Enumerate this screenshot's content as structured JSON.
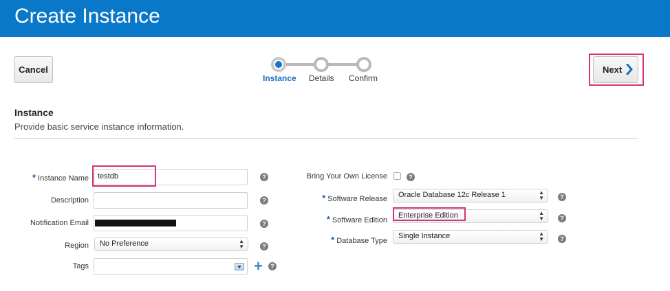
{
  "header": {
    "title": "Create Instance"
  },
  "toolbar": {
    "cancel_label": "Cancel",
    "next_label": "Next"
  },
  "train": {
    "steps": [
      {
        "label": "Instance",
        "active": true
      },
      {
        "label": "Details",
        "active": false
      },
      {
        "label": "Confirm",
        "active": false
      }
    ]
  },
  "section": {
    "title": "Instance",
    "subtitle": "Provide basic service instance information."
  },
  "form_left": {
    "instance_name": {
      "label": "Instance Name",
      "value": "testdb",
      "required": "*"
    },
    "description": {
      "label": "Description",
      "value": ""
    },
    "notification_email": {
      "label": "Notification Email",
      "value": ""
    },
    "region": {
      "label": "Region",
      "value": "No Preference"
    },
    "tags": {
      "label": "Tags",
      "value": ""
    }
  },
  "form_right": {
    "byol": {
      "label": "Bring Your Own License",
      "checked": false
    },
    "software_release": {
      "label": "Software Release",
      "value": "Oracle Database 12c Release 1",
      "required": "*"
    },
    "software_edition": {
      "label": "Software Edition",
      "value": "Enterprise Edition",
      "required": "*"
    },
    "database_type": {
      "label": "Database Type",
      "value": "Single Instance",
      "required": "*"
    }
  },
  "help_glyph": "?",
  "icons": {
    "help": "question-circle-icon",
    "next": "chevron-right-icon",
    "tags_dropdown": "dropdown-arrow-icon",
    "add_tag": "plus-icon",
    "select_arrows": "updown-arrows-icon"
  },
  "colors": {
    "header_bg": "#0a78c9",
    "accent": "#1a73c8",
    "highlight": "#d6317a"
  }
}
